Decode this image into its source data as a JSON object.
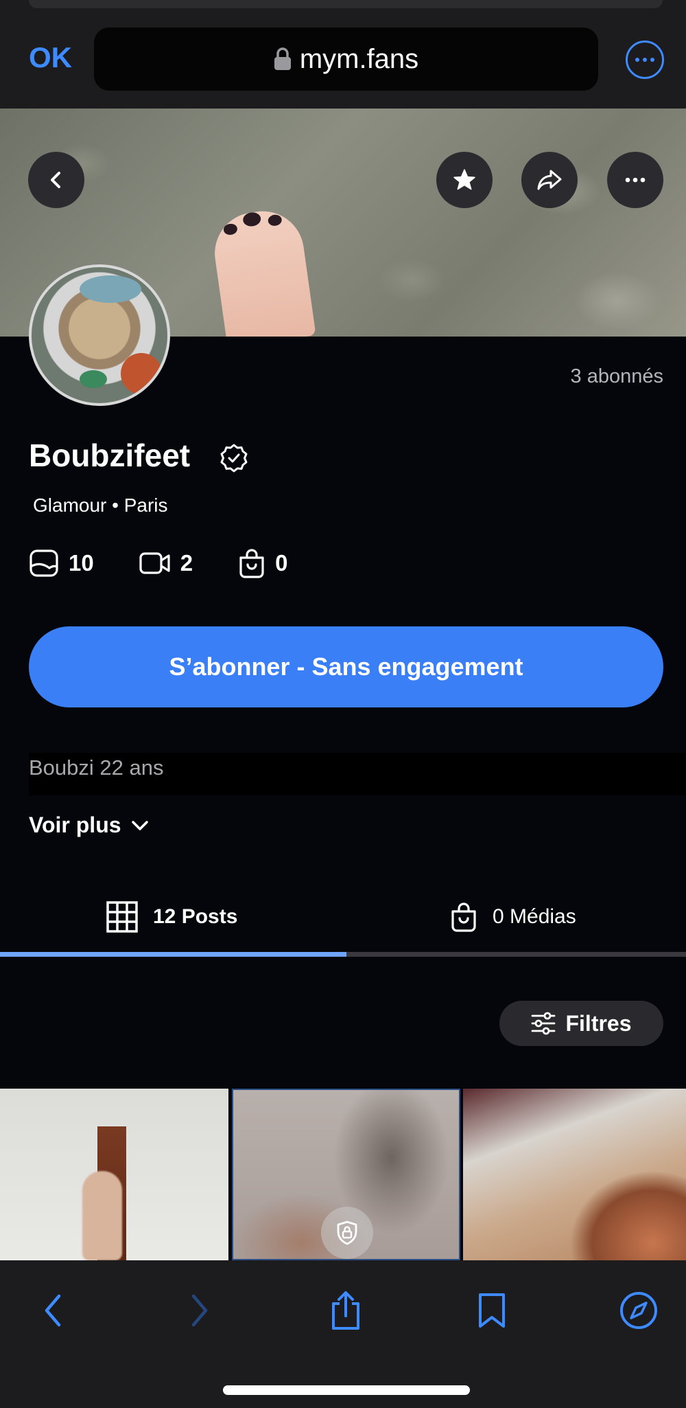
{
  "browser": {
    "ok_label": "OK",
    "url": "mym.fans",
    "accent_color": "#3d8bff"
  },
  "banner": {
    "icons": [
      "back-chevron-icon",
      "star-icon",
      "share-arrow-icon",
      "more-dots-icon"
    ]
  },
  "profile": {
    "subscribers": "3 abonnés",
    "name": "Boubzifeet",
    "tags": "Glamour • Paris",
    "stats": [
      {
        "icon": "photo-icon",
        "value": "10"
      },
      {
        "icon": "video-icon",
        "value": "2"
      },
      {
        "icon": "bag-icon",
        "value": "0"
      }
    ],
    "subscribe_label": "S’abonner - Sans engagement",
    "subscribe_color": "#3a7ff6",
    "bio": "Boubzi 22 ans",
    "voir_plus": "Voir plus"
  },
  "tabs": [
    {
      "label": "12 Posts",
      "icon": "grid-icon",
      "active": true
    },
    {
      "label": "0 Médias",
      "icon": "bag-icon",
      "active": false
    }
  ],
  "filters_label": "Filtres",
  "toolbar": {
    "icons": [
      "back-icon",
      "forward-icon",
      "share-icon",
      "bookmarks-icon",
      "compass-icon"
    ]
  }
}
